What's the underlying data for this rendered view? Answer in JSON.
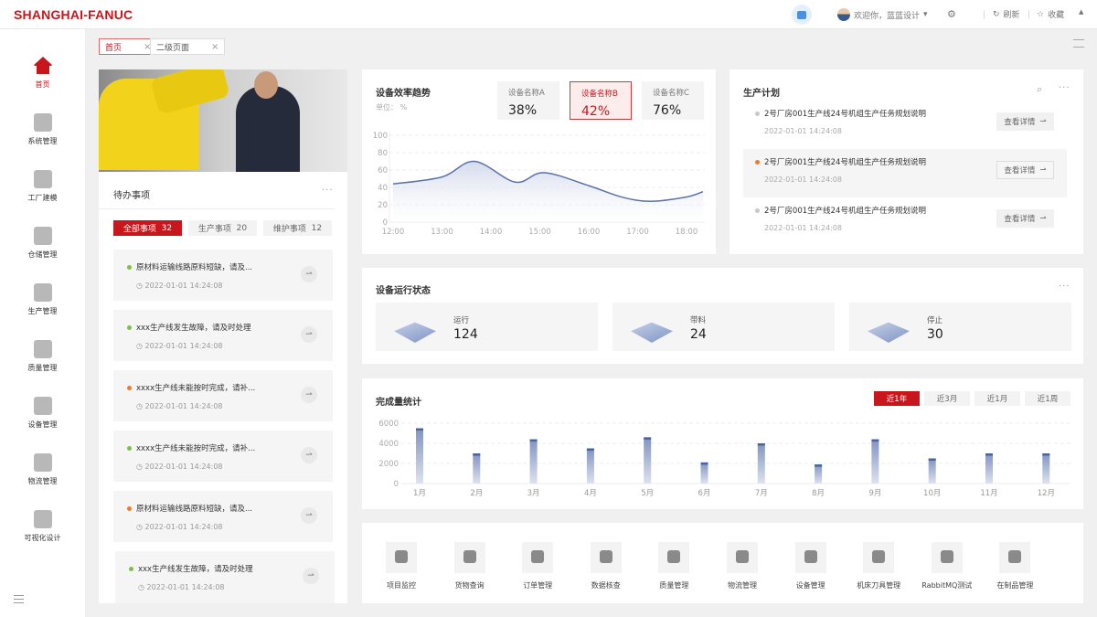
{
  "header": {
    "logo": "SHANGHAI-FANUC",
    "welcome": "欢迎你，蓝蓝设计",
    "refresh": "刷新",
    "favorite": "收藏",
    "icons": [
      "calendar-icon",
      "user-avatar",
      "gear-icon",
      "refresh-icon",
      "star-icon",
      "triangle-up-icon"
    ]
  },
  "sidebar": {
    "items": [
      {
        "label": "首页",
        "icon": "home-icon",
        "active": true
      },
      {
        "label": "系统管理",
        "icon": "grid-icon"
      },
      {
        "label": "工厂建模",
        "icon": "robot-arm-icon"
      },
      {
        "label": "仓储管理",
        "icon": "warehouse-icon"
      },
      {
        "label": "生产管理",
        "icon": "production-icon"
      },
      {
        "label": "质量管理",
        "icon": "diamond-icon"
      },
      {
        "label": "设备管理",
        "icon": "truck-icon"
      },
      {
        "label": "物流管理",
        "icon": "books-icon"
      },
      {
        "label": "可视化设计",
        "icon": "monitor-chart-icon"
      }
    ]
  },
  "tabs": [
    {
      "label": "首页",
      "active": true
    },
    {
      "label": "二级页面"
    }
  ],
  "todo": {
    "title": "待办事项",
    "filters": [
      {
        "label": "全部事项",
        "count": "32"
      },
      {
        "label": "生产事项",
        "count": "20"
      },
      {
        "label": "维护事项",
        "count": "12"
      }
    ],
    "items": [
      {
        "text": "原材料运输线路原料短缺，请及...",
        "time": "2022-01-01  14:24:08",
        "status": "#7cc242"
      },
      {
        "text": "xxx生产线发生故障，请及时处理",
        "time": "2022-01-01  14:24:08",
        "status": "#7cc242"
      },
      {
        "text": "xxxx生产线未能按时完成，请补...",
        "time": "2022-01-01  14:24:08",
        "status": "#f07a2a"
      },
      {
        "text": "xxxx生产线未能按时完成，请补...",
        "time": "2022-01-01  14:24:08",
        "status": "#7cc242"
      },
      {
        "text": "原材料运输线路原料短缺，请及...",
        "time": "2022-01-01  14:24:08",
        "status": "#f07a2a"
      },
      {
        "text": "xxx生产线发生故障，请及时处理",
        "time": "2022-01-01  14:24:08",
        "status": "#7cc242"
      }
    ]
  },
  "efficiency": {
    "title": "设备效率趋势",
    "unit": "单位： %",
    "metrics": [
      {
        "label": "设备名称A",
        "value": "38%"
      },
      {
        "label": "设备名称B",
        "value": "42%",
        "active": true
      },
      {
        "label": "设备名称C",
        "value": "76%"
      }
    ]
  },
  "plan": {
    "title": "生产计划",
    "button": "查看详情",
    "items": [
      {
        "text": "2号厂房001生产线24号机组生产任务规划说明",
        "time": "2022-01-01  14:24:08",
        "status": "#c8c8c8"
      },
      {
        "text": "2号厂房001生产线24号机组生产任务规划说明",
        "time": "2022-01-01  14:24:08",
        "status": "#f07a2a"
      },
      {
        "text": "2号厂房001生产线24号机组生产任务规划说明",
        "time": "2022-01-01  14:24:08",
        "status": "#c8c8c8"
      }
    ]
  },
  "status": {
    "title": "设备运行状态",
    "items": [
      {
        "label": "运行",
        "value": "124"
      },
      {
        "label": "带料",
        "value": "24"
      },
      {
        "label": "停止",
        "value": "30"
      }
    ]
  },
  "completion": {
    "title": "完成量统计",
    "ranges": [
      {
        "label": "近1年",
        "active": true
      },
      {
        "label": "近3月"
      },
      {
        "label": "近1月"
      },
      {
        "label": "近1周"
      }
    ]
  },
  "apps": [
    {
      "label": "项目监控",
      "icon": "camera-icon"
    },
    {
      "label": "货物查询",
      "icon": "package-search-icon"
    },
    {
      "label": "订单管理",
      "icon": "clipboard-icon"
    },
    {
      "label": "数据核查",
      "icon": "monitor-icon"
    },
    {
      "label": "质量管理",
      "icon": "shield-check-icon"
    },
    {
      "label": "物流管理",
      "icon": "gear-icon"
    },
    {
      "label": "设备管理",
      "icon": "tag-icon"
    },
    {
      "label": "机床刀具管理",
      "icon": "drill-icon"
    },
    {
      "label": "RabbitMQ测试",
      "icon": "sliders-icon"
    },
    {
      "label": "在制品管理",
      "icon": "box-icon"
    }
  ],
  "chart_data": [
    {
      "type": "area",
      "ylim": [
        0,
        100
      ],
      "yticks": [
        0,
        20,
        40,
        60,
        80,
        100
      ],
      "xticks": [
        "12:00",
        "13:00",
        "14:00",
        "15:00",
        "16:00",
        "17:00",
        "18:00"
      ],
      "grid": true,
      "color": "#5a72a8",
      "points": [
        [
          "12:00",
          44
        ],
        [
          "13:00",
          52
        ],
        [
          "13:40",
          70
        ],
        [
          "14:30",
          46
        ],
        [
          "15:05",
          57
        ],
        [
          "16:00",
          42
        ],
        [
          "16:40",
          29
        ],
        [
          "17:15",
          24
        ],
        [
          "18:00",
          29
        ],
        [
          "18:20",
          35
        ]
      ]
    },
    {
      "type": "bar",
      "categories": [
        "1月",
        "2月",
        "3月",
        "4月",
        "5月",
        "6月",
        "7月",
        "8月",
        "9月",
        "10月",
        "11月",
        "12月"
      ],
      "values": [
        5500,
        3000,
        4400,
        3500,
        4600,
        2100,
        4000,
        1900,
        4400,
        2500,
        3000,
        3000
      ],
      "ylim": [
        0,
        6000
      ],
      "yticks": [
        0,
        2000,
        4000,
        6000
      ],
      "grid": true,
      "color": "#4a64a0"
    }
  ]
}
